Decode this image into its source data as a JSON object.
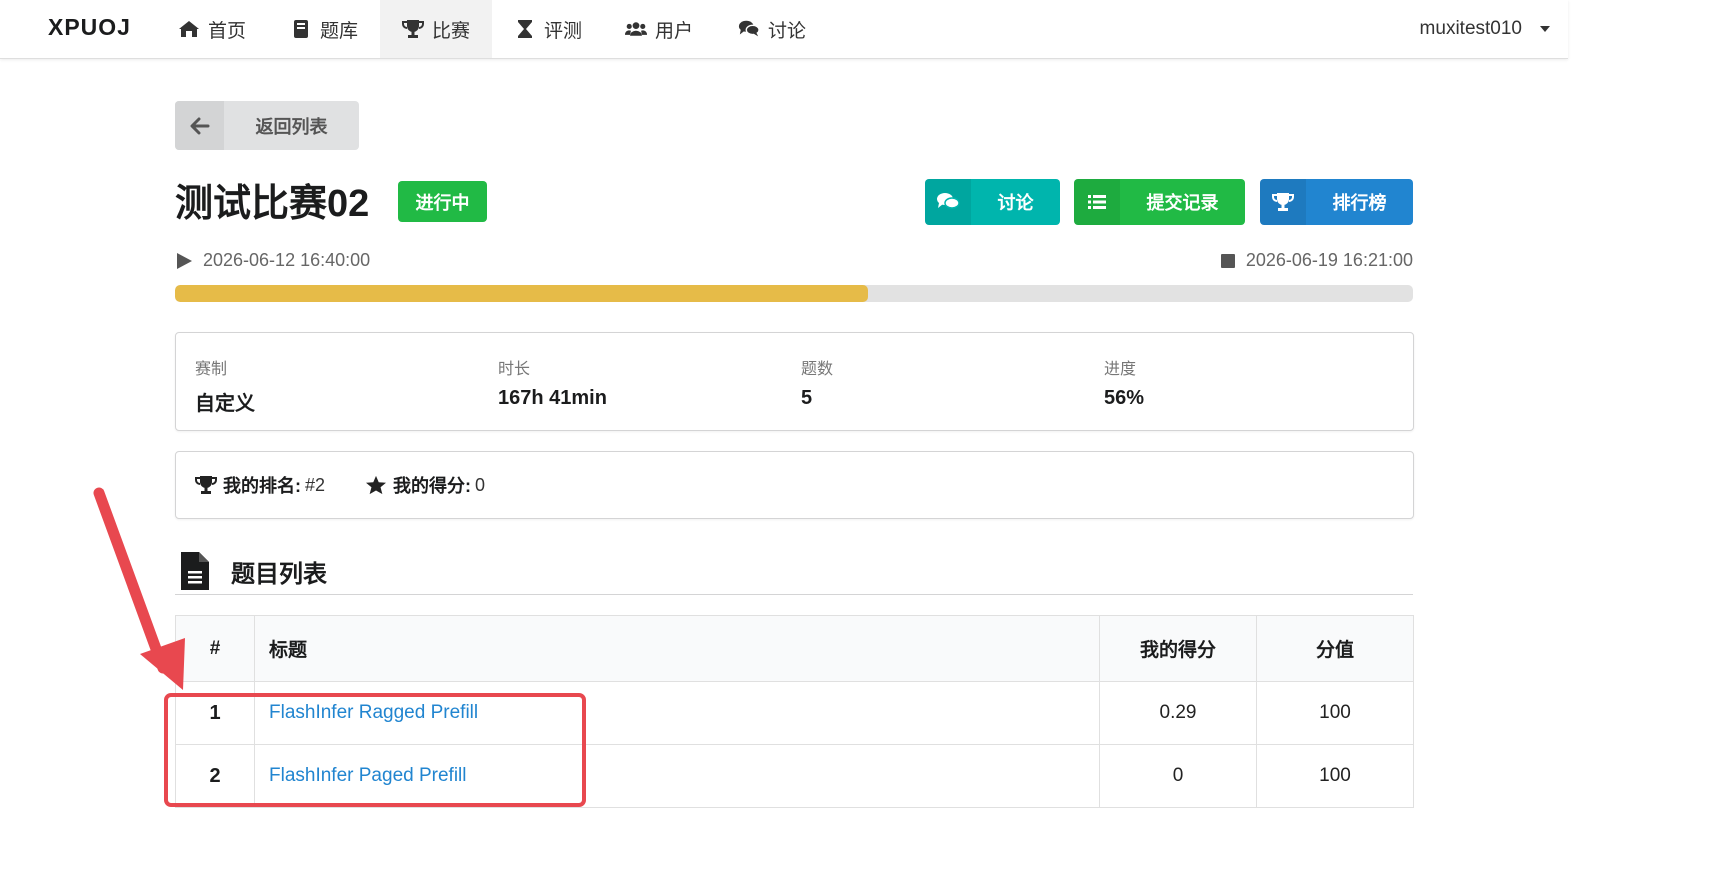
{
  "nav": {
    "brand": "XPUOJ",
    "items": [
      {
        "label": "首页",
        "icon": "home-icon"
      },
      {
        "label": "题库",
        "icon": "book-icon"
      },
      {
        "label": "比赛",
        "icon": "trophy-icon"
      },
      {
        "label": "评测",
        "icon": "hourglass-icon"
      },
      {
        "label": "用户",
        "icon": "users-icon"
      },
      {
        "label": "讨论",
        "icon": "comments-icon"
      }
    ],
    "active": "比赛",
    "username": "muxitest010"
  },
  "back_button": {
    "label": "返回列表",
    "icon": "arrow-left-icon"
  },
  "contest": {
    "title": "测试比赛02",
    "status": "进行中",
    "status_color": "#21ba45",
    "start_time": "2026-06-12 16:40:00",
    "end_time": "2026-06-19 16:21:00",
    "progress_fraction": 0.56,
    "progress_color": "#e6bb48"
  },
  "actions": {
    "discuss_label": "讨论",
    "submissions_label": "提交记录",
    "rank_label": "排行榜",
    "colors": {
      "discuss": "#00b5ad",
      "submissions": "#21ba45",
      "rank": "#2185d0"
    }
  },
  "info": {
    "format": {
      "label": "赛制",
      "value": "自定义"
    },
    "duration": {
      "label": "时长",
      "value": "167h 41min"
    },
    "problem_count": {
      "label": "题数",
      "value": "5"
    },
    "progress": {
      "label": "进度",
      "value": "56%"
    }
  },
  "my_stats": {
    "rank_label": "我的排名:",
    "rank_value": "#2",
    "score_label": "我的得分:",
    "score_value": "0"
  },
  "problem_section": {
    "title": "题目列表",
    "columns": {
      "num": "#",
      "title": "标题",
      "my_score": "我的得分",
      "value": "分值"
    },
    "rows": [
      {
        "num": "1",
        "title": "FlashInfer Ragged Prefill",
        "my_score": "0.29",
        "value": "100"
      },
      {
        "num": "2",
        "title": "FlashInfer Paged Prefill",
        "my_score": "0",
        "value": "100"
      }
    ]
  },
  "annotation_color": "#e8484f"
}
